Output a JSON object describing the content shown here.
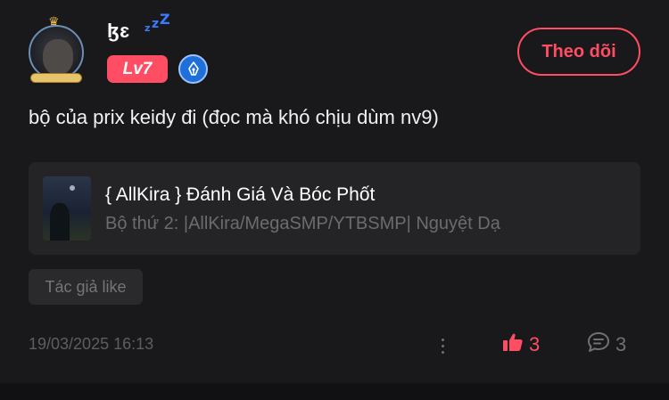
{
  "post": {
    "author": {
      "name": "ɮɛ",
      "sleep_glyph": "zzZ",
      "level": "Lv7",
      "avatar_icon": "avatar-icon",
      "badge_icon": "pen-nib-icon"
    },
    "follow_label": "Theo dõi",
    "text": "bộ của prix keidy đi (đọc mà khó chịu dùm nv9)",
    "linked_story": {
      "title": "{ AllKira } Đánh Giá Và Bóc Phốt",
      "subtitle": "Bộ thứ 2: |AllKira/MegaSMP/YTBSMP| Nguyệt Dạ"
    },
    "tag": "Tác giả like",
    "timestamp": "19/03/2025 16:13",
    "likes": "3",
    "comments": "3"
  },
  "colors": {
    "accent": "#ff4d63",
    "background": "#19191b",
    "card": "#242427",
    "muted": "#6f6f75",
    "badge_blue": "#1e6fd9"
  }
}
